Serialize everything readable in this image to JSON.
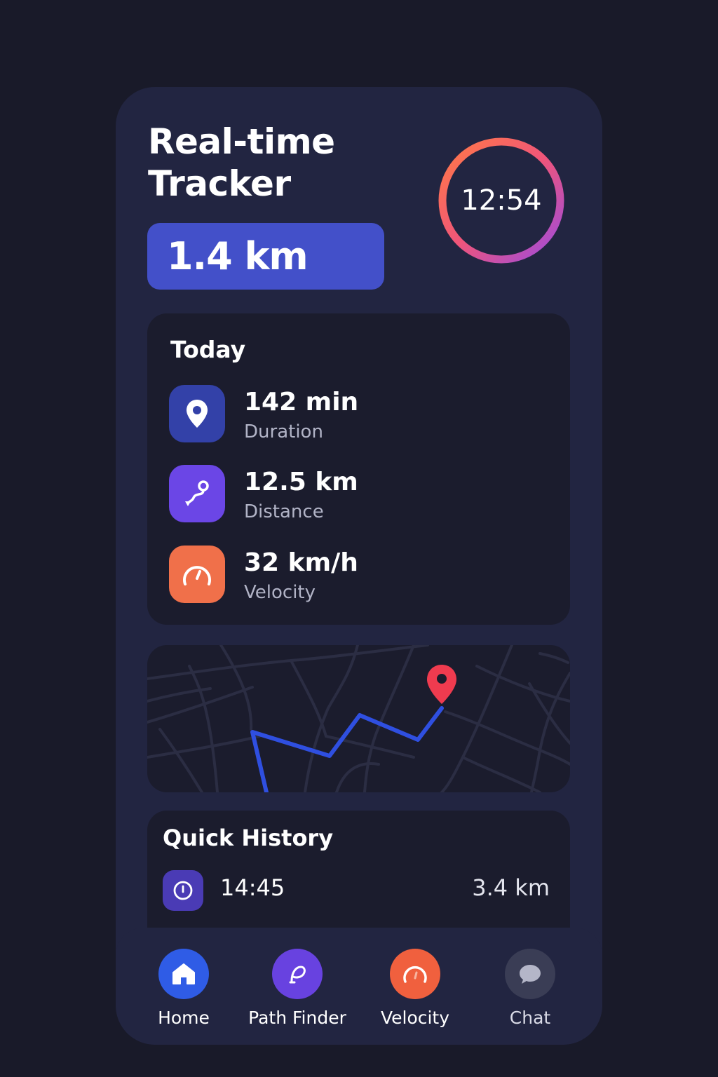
{
  "app": {
    "title": "Real-time Tracker"
  },
  "header": {
    "distance": "1.4 km",
    "timer": "12:54"
  },
  "today": {
    "title": "Today",
    "stats": [
      {
        "value": "142 min",
        "label": "Duration",
        "icon": "location-pin-icon",
        "color": "#3341a8"
      },
      {
        "value": "12.5 km",
        "label": "Distance",
        "icon": "route-icon",
        "color": "#6b46e6"
      },
      {
        "value": "32 km/h",
        "label": "Velocity",
        "icon": "speedometer-icon",
        "color": "#f0704a"
      }
    ]
  },
  "history": {
    "title": "Quick History",
    "items": [
      {
        "time": "14:45",
        "distance": "3.4 km",
        "icon": "clock-icon"
      }
    ]
  },
  "nav": [
    {
      "label": "Home",
      "icon": "home-icon",
      "color": "#2f5ce6"
    },
    {
      "label": "Path Finder",
      "icon": "path-icon",
      "color": "#6842e0"
    },
    {
      "label": "Velocity",
      "icon": "speedometer-icon",
      "color": "#f0603e"
    },
    {
      "label": "Chat",
      "icon": "chat-icon",
      "color": "#3a3d55"
    }
  ],
  "colors": {
    "background": "#191a29",
    "panel": "#222541",
    "card": "#1b1c2d",
    "accent": "#4350c9",
    "route": "#2f4fe0",
    "marker": "#ef3b4f"
  }
}
